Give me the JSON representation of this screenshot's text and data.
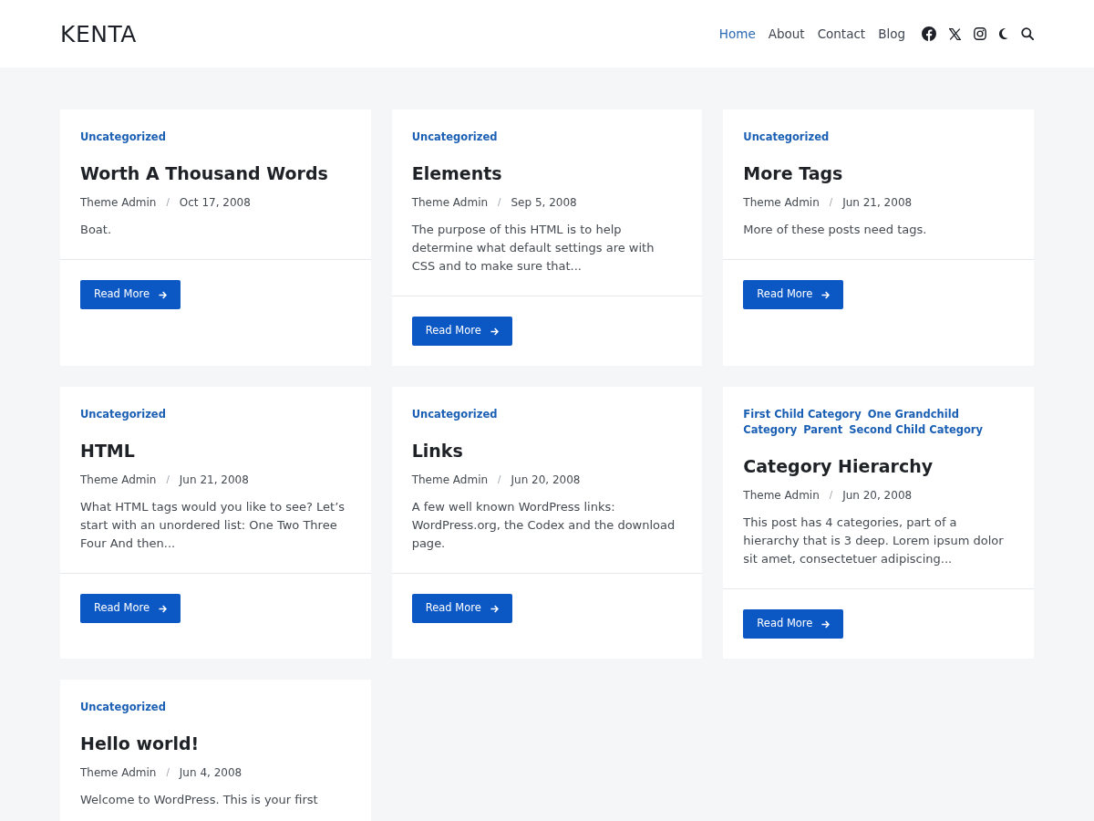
{
  "header": {
    "logo": "KENTA",
    "nav": [
      {
        "label": "Home",
        "selected": true
      },
      {
        "label": "About",
        "selected": false
      },
      {
        "label": "Contact",
        "selected": false
      },
      {
        "label": "Blog",
        "selected": false
      }
    ]
  },
  "posts": [
    {
      "categories": [
        "Uncategorized"
      ],
      "title": "Worth A Thousand Words",
      "author": "Theme Admin",
      "separator": "/",
      "date": "Oct 17, 2008",
      "excerpt": "Boat.",
      "button": "Read More"
    },
    {
      "categories": [
        "Uncategorized"
      ],
      "title": "Elements",
      "author": "Theme Admin",
      "separator": "/",
      "date": "Sep 5, 2008",
      "excerpt": "The purpose of this HTML is to help determine what default settings are with CSS and to make sure that...",
      "button": "Read More"
    },
    {
      "categories": [
        "Uncategorized"
      ],
      "title": "More Tags",
      "author": "Theme Admin",
      "separator": "/",
      "date": "Jun 21, 2008",
      "excerpt": "More of these posts need tags.",
      "button": "Read More"
    },
    {
      "categories": [
        "Uncategorized"
      ],
      "title": "HTML",
      "author": "Theme Admin",
      "separator": "/",
      "date": "Jun 21, 2008",
      "excerpt": "What HTML tags would you like to see? Let’s start with an unordered list: One Two Three Four And then...",
      "button": "Read More"
    },
    {
      "categories": [
        "Uncategorized"
      ],
      "title": "Links",
      "author": "Theme Admin",
      "separator": "/",
      "date": "Jun 20, 2008",
      "excerpt": "A few well known WordPress links: WordPress.org, the Codex and the download page.",
      "button": "Read More"
    },
    {
      "categories": [
        "First Child Category",
        "One Grandchild Category",
        "Parent",
        "Second Child Category"
      ],
      "title": "Category Hierarchy",
      "author": "Theme Admin",
      "separator": "/",
      "date": "Jun 20, 2008",
      "excerpt": "This post has 4 categories, part of a hierarchy that is 3 deep. Lorem ipsum dolor sit amet, consectetuer adipiscing...",
      "button": "Read More"
    },
    {
      "categories": [
        "Uncategorized"
      ],
      "title": "Hello world!",
      "author": "Theme Admin",
      "separator": "/",
      "date": "Jun 4, 2008",
      "excerpt": "Welcome to WordPress. This is your first"
    }
  ]
}
